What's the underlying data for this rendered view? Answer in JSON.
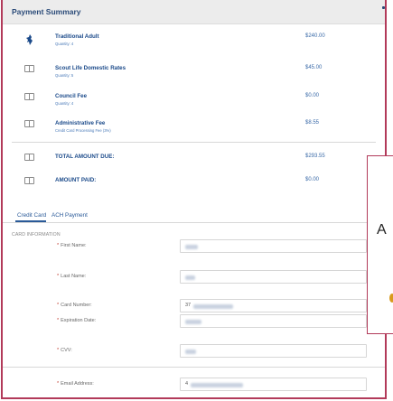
{
  "summary": {
    "title": "Payment Summary"
  },
  "line_items": [
    {
      "icon": "scout-emblem-icon",
      "name": "Traditional Adult",
      "sub": "Quantity: 4",
      "amount": "$240.00"
    },
    {
      "icon": "book-icon",
      "name": "Scout Life Domestic Rates",
      "sub": "Quantity: 5",
      "amount": "$45.00"
    },
    {
      "icon": "book-icon",
      "name": "Council Fee",
      "sub": "Quantity: 4",
      "amount": "$0.00"
    },
    {
      "icon": "book-icon",
      "name": "Administrative Fee",
      "sub": "Credit Card Processing Fee (3%)",
      "amount": "$8.55"
    }
  ],
  "totals": [
    {
      "icon": "book-icon",
      "label": "TOTAL AMOUNT DUE:",
      "amount": "$293.55"
    },
    {
      "icon": "book-icon",
      "label": "AMOUNT PAID:",
      "amount": "$0.00"
    }
  ],
  "tabs": [
    {
      "label": "Credit Card",
      "active": true
    },
    {
      "label": "ACH Payment",
      "active": false
    }
  ],
  "card_section": {
    "title": "CARD INFORMATION"
  },
  "fields": [
    {
      "label": "First Name:",
      "prefix": ""
    },
    {
      "label": "Last Name:",
      "prefix": ""
    },
    {
      "label": "Card Number:",
      "prefix": "37"
    },
    {
      "label": "Expiration Date:",
      "prefix": ""
    },
    {
      "label": "CVV:",
      "prefix": ""
    },
    {
      "label": "Email Address:",
      "prefix": "4"
    }
  ],
  "required_marker": "*",
  "modal": {
    "visible_letter": "A"
  },
  "colors": {
    "accent": "#2a5a98",
    "frame": "#b23a5a",
    "required": "#c0392b"
  }
}
